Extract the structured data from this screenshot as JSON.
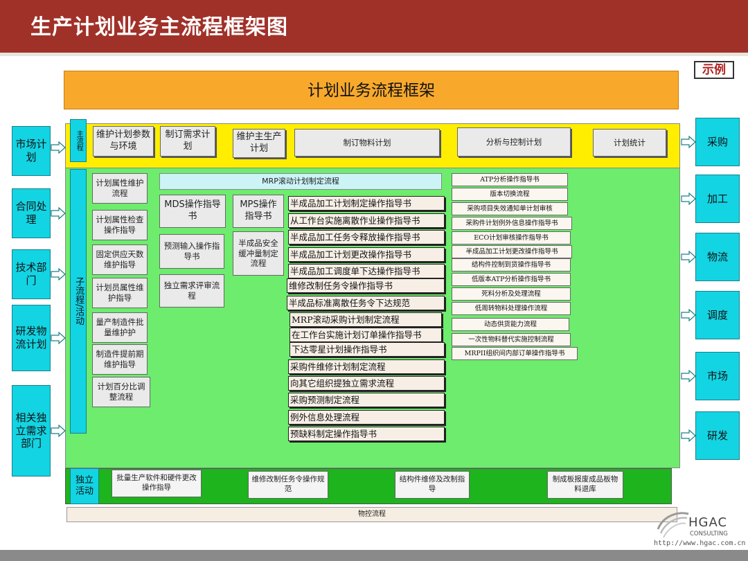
{
  "page": {
    "title": "生产计划业务主流程框架图",
    "legend": "示例"
  },
  "banner": {
    "title": "计划业务流程框架"
  },
  "left_inputs": [
    "市场计划",
    "合同处理",
    "技术部门",
    "研发物流计划",
    "相关独立需求部门"
  ],
  "right_outputs": [
    "采购",
    "加工",
    "物流",
    "调度",
    "市场",
    "研发"
  ],
  "main_flow": {
    "label": "主流程",
    "items": [
      "维护计划参数与环境",
      "制订需求计划",
      "维护主生产计划",
      "制订物料计划",
      "分析与控制计划",
      "计划统计"
    ]
  },
  "sub_flow": {
    "label": "子流程/活动",
    "col1": [
      "计划属性维护流程",
      "计划属性检查操作指导",
      "固定供应天数维护指导",
      "计划员属性维护指导",
      "量产制造件批量维护护",
      "制造件提前期维护指导",
      "计划百分比调整流程"
    ],
    "mds": [
      "MDS操作指导书",
      "预测输入操作指导书",
      "独立需求评审流程"
    ],
    "mps": [
      "MPS操作指导书",
      "半成品安全缓冲量制定流程"
    ],
    "mrp_header": "MRP滚动计划制定流程",
    "mrp_docs": [
      "半成品加工计划制定操作指导书",
      "从工作台实施离散作业操作指导书",
      "半成品加工任务令释放操作指导书",
      "半成品加工计划更改操作指导书",
      "半成品加工调度单下达操作指导书",
      "维修改制任务令操作指导书",
      "半成品标准离散任务令下达规范",
      "MRP滚动采购计划制定流程",
      "在工作台实施计划订单操作指导书",
      "下达零星计划操作指导书",
      "采购件维修计划制定流程",
      "向其它组织提独立需求流程",
      "采购预测制定流程",
      "例外信息处理流程",
      "预缺料制定操作指导书"
    ],
    "analysis_docs": [
      "ATP分析操作指导书",
      "版本切换流程",
      "采购项目失效通知单计划审核",
      "采购件计划例外信息操作指导书",
      "ECO计划审核操作指导书",
      "半成品加工计划更改操作指导书",
      "结构件控制到货操作指导书",
      "低版本ATP分析操作指导书",
      "死料分析及处理流程",
      "低周转物料处理操作流程",
      "动态供货能力流程",
      "一次性物料替代实施控制流程",
      "MRPII组织间内部订单操作指导书"
    ]
  },
  "independent": {
    "label": "独立活动",
    "items": [
      "批量生产软件和硬件更改操作指导",
      "维修改制任务令操作规范",
      "结构件维修及改制指导",
      "制成板报废成品板物料退库"
    ]
  },
  "footer": {
    "flow": "物控流程",
    "logo": "HGAC",
    "logo_sub": "CONSULTING",
    "url": "http://www.hgac.com.cn"
  },
  "colors": {
    "header": "#a03129",
    "banner": "#f8a92c",
    "main_band": "#ffee00",
    "sub_area": "#6dec6d",
    "indep_band": "#1db41d",
    "cyan": "#13d4e3"
  }
}
